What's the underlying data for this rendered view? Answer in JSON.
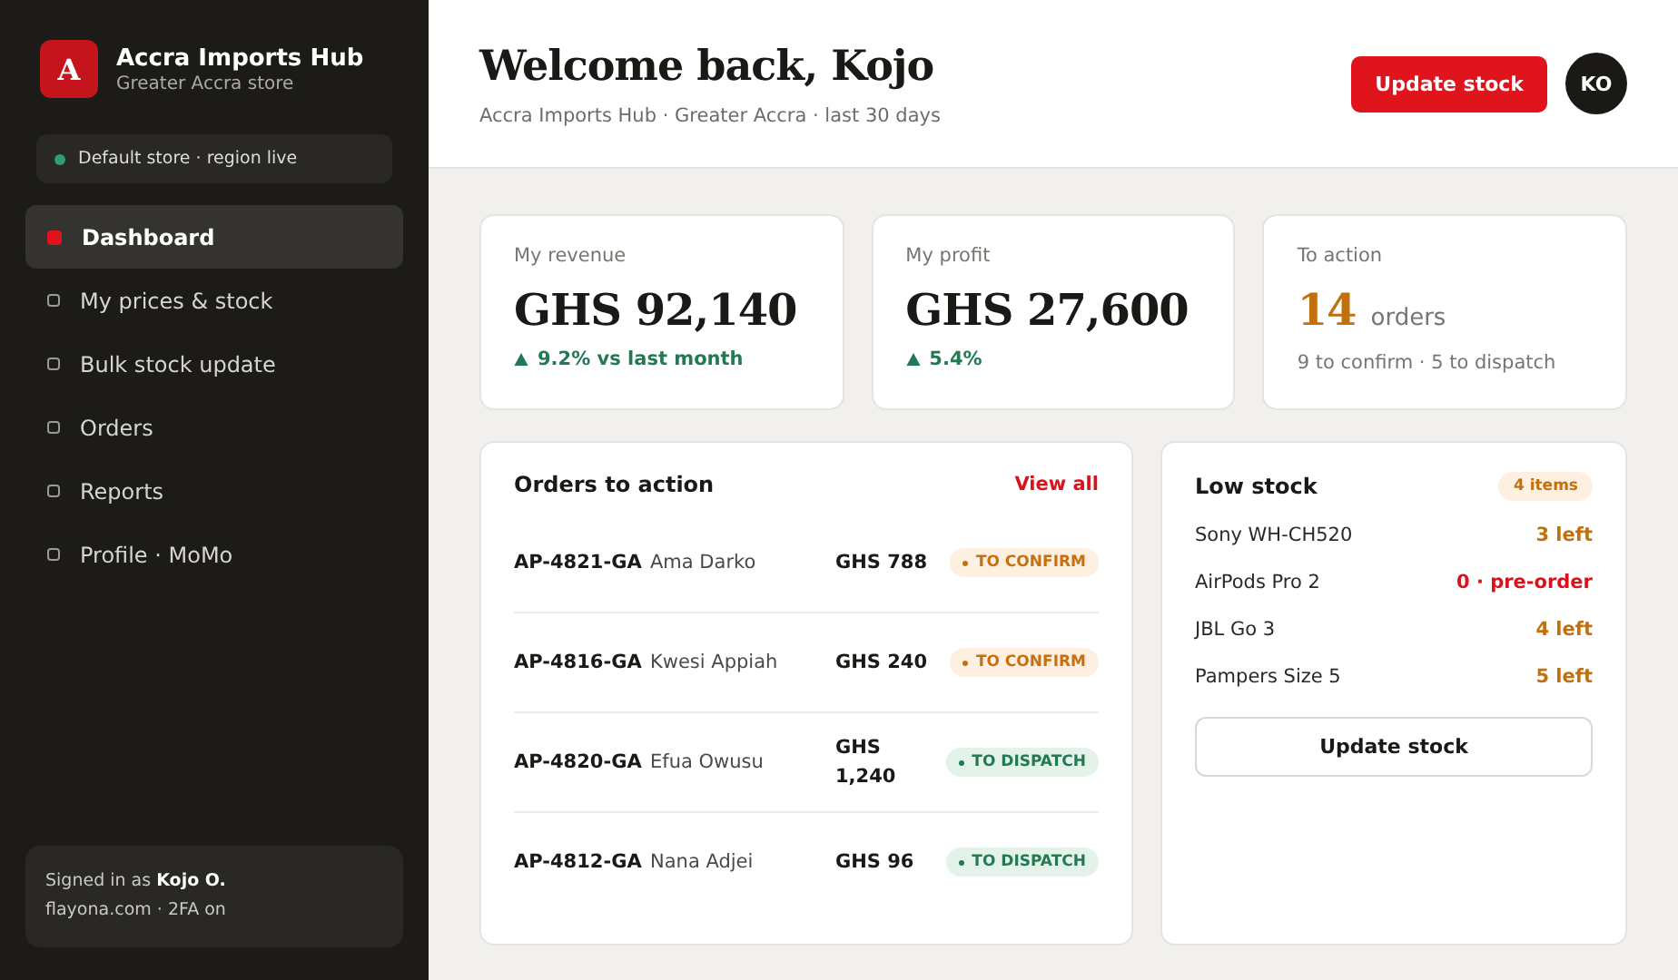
{
  "sidebar": {
    "brand": {
      "letter": "A",
      "name": "Accra Imports Hub",
      "subtitle": "Greater Accra store"
    },
    "store_status": {
      "label": "Default store · region live",
      "color": "#2e9e6a"
    },
    "items": [
      {
        "label": "Dashboard",
        "selected": true
      },
      {
        "label": "My prices & stock",
        "selected": false
      },
      {
        "label": "Bulk stock update",
        "selected": false
      },
      {
        "label": "Orders",
        "selected": false
      },
      {
        "label": "Reports",
        "selected": false
      },
      {
        "label": "Profile · MoMo",
        "selected": false
      }
    ],
    "account": {
      "signed_in": "Signed in as **Kojo O.**",
      "detail": "flayona.com · 2FA on"
    }
  },
  "header": {
    "title": "Welcome back, Kojo",
    "subtitle": "Accra Imports Hub · Greater Accra · last 30 days",
    "button": "Update stock",
    "avatar": "KO"
  },
  "stats": [
    {
      "kind": "money",
      "label": "My revenue",
      "value": "GHS 92,140",
      "delta": "9.2% vs last month"
    },
    {
      "kind": "money",
      "label": "My profit",
      "value": "GHS 27,600",
      "delta": "5.4%"
    },
    {
      "kind": "count",
      "label": "To action",
      "value": "14",
      "unit": "orders",
      "detail": "9 to confirm · 5 to dispatch"
    }
  ],
  "orders": {
    "title": "Orders to action",
    "link": "View all",
    "rows": [
      {
        "id": "AP-4821-GA",
        "customer": "Ama Darko",
        "amount": "GHS 788",
        "status": "TO CONFIRM",
        "kind": "confirm"
      },
      {
        "id": "AP-4816-GA",
        "customer": "Kwesi Appiah",
        "amount": "GHS 240",
        "status": "TO CONFIRM",
        "kind": "confirm"
      },
      {
        "id": "AP-4820-GA",
        "customer": "Efua Owusu",
        "amount": "GHS 1,240",
        "status": "TO DISPATCH",
        "kind": "dispatch"
      },
      {
        "id": "AP-4812-GA",
        "customer": "Nana Adjei",
        "amount": "GHS 96",
        "status": "TO DISPATCH",
        "kind": "dispatch"
      }
    ]
  },
  "low_stock": {
    "title": "Low stock",
    "badge": "4 items",
    "items": [
      {
        "name": "Sony WH-CH520",
        "stock": "3 left",
        "kind": "low"
      },
      {
        "name": "AirPods Pro 2",
        "stock": "0 · pre-order",
        "kind": "out"
      },
      {
        "name": "JBL Go 3",
        "stock": "4 left",
        "kind": "low"
      },
      {
        "name": "Pampers Size 5",
        "stock": "5 left",
        "kind": "low"
      }
    ],
    "button": "Update stock"
  }
}
